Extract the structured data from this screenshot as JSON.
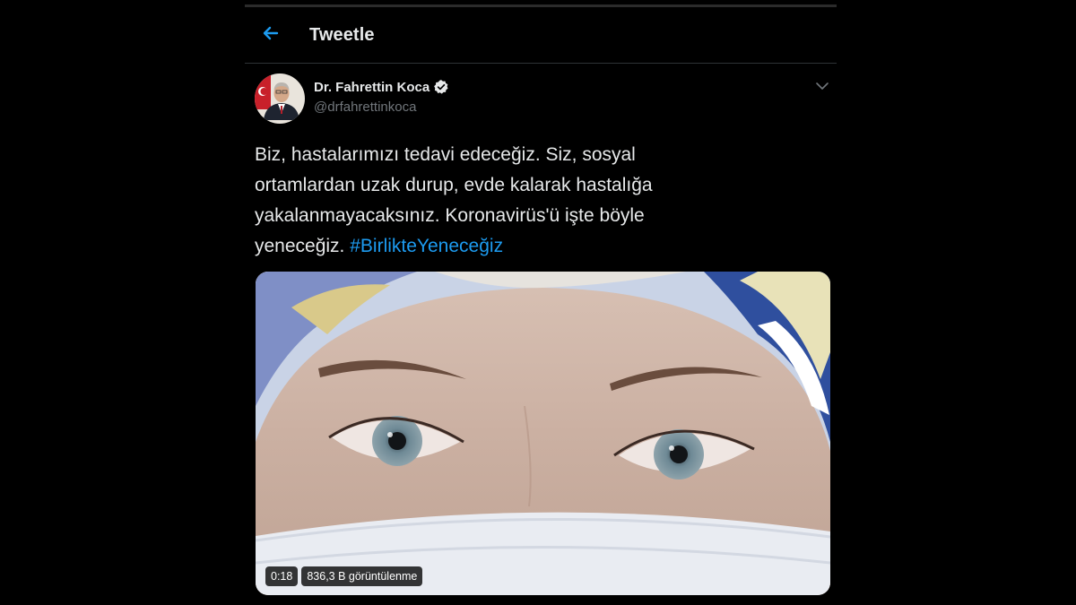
{
  "header": {
    "back_icon": "arrow-left-icon",
    "title": "Tweetle"
  },
  "tweet": {
    "author_name": "Dr. Fahrettin Koca",
    "verified_icon": "verified-badge-icon",
    "handle": "@drfahrettinkoca",
    "more_icon": "chevron-down-icon",
    "text": "Biz, hastalarımızı tedavi edeceğiz. Siz, sosyal\nortamlardan uzak durup, evde kalarak hastalığa\nyakalanmayacaksınız. Koronavirüs'ü işte böyle\nyeneceğiz. ",
    "hashtag": "#BirlikteYeneceğiz"
  },
  "media": {
    "duration": "0:18",
    "views": "836,3 B görüntülenme"
  },
  "colors": {
    "background": "#000000",
    "text": "#e7e9ea",
    "secondary": "#71767b",
    "accent": "#1d9bf0"
  }
}
